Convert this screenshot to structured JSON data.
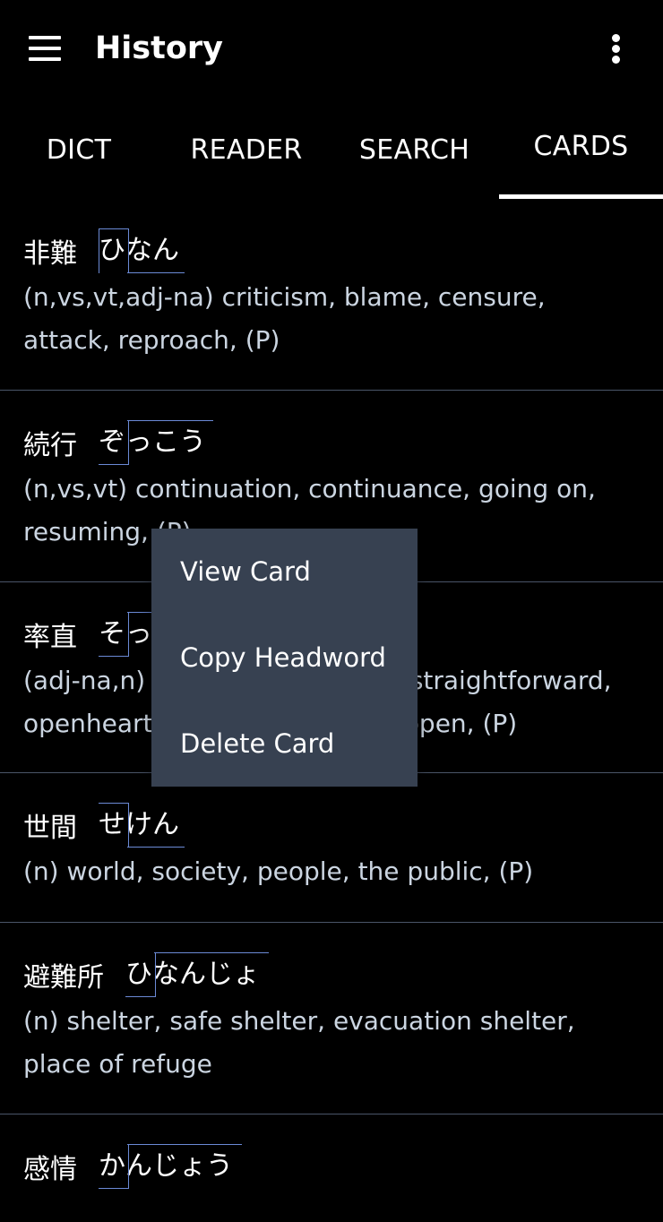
{
  "appbar": {
    "title": "History",
    "menu_icon": "hamburger-menu-icon",
    "overflow_icon": "more-vertical-icon"
  },
  "tabs": [
    {
      "label": "DICT"
    },
    {
      "label": "READER"
    },
    {
      "label": "SEARCH"
    },
    {
      "label": "CARDS",
      "selected": true
    }
  ],
  "cards": [
    {
      "headword": "非難",
      "reading_pre": "ひ",
      "reading_post": "なん",
      "gloss": "(n,vs,vt,adj-na) criticism, blame, censure, attack, reproach, (P)"
    },
    {
      "headword": "続行",
      "reading_pre": "ぞ",
      "reading_post": "っこう",
      "gloss": "(n,vs,vt) continuation, continuance, going on, resuming, (P)"
    },
    {
      "headword": "率直",
      "reading_pre": "そ",
      "reading_post": "っちょく",
      "gloss": "(adj-na,n) frankness, candour, straightforward, openhearted, outspokenness, open, (P)"
    },
    {
      "headword": "世間",
      "reading_pre": "せ",
      "reading_post": "けん",
      "gloss": "(n) world, society, people, the public, (P)"
    },
    {
      "headword": "避難所",
      "reading_pre": "ひ",
      "reading_post": "なんじょ",
      "gloss": "(n) shelter, safe shelter, evacuation shelter, place of refuge"
    },
    {
      "headword": "感情",
      "reading_pre": "か",
      "reading_post": "んじょう",
      "gloss": ""
    }
  ],
  "context_menu": {
    "items": [
      {
        "label": "View Card"
      },
      {
        "label": "Copy Headword"
      },
      {
        "label": "Delete Card"
      }
    ]
  },
  "colors": {
    "background": "#000000",
    "divider": "#4a5568",
    "menu_bg": "#374151",
    "pitch_accent": "#6b8ad6",
    "gloss_text": "#cbd5e1"
  }
}
